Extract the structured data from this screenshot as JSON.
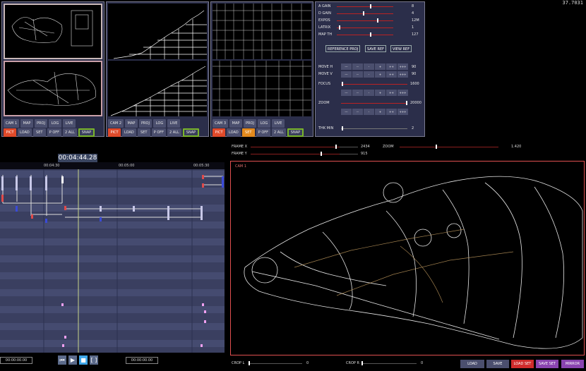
{
  "fps": "37.7031",
  "cameras": [
    {
      "name": "CAM 1",
      "row1": [
        "CAM 1",
        "MAP",
        "PROJ",
        "LOG",
        "LIVE"
      ],
      "row2": [
        "PICT",
        "LOAD",
        "SET",
        "P OFF",
        "2 ALL",
        "SNAP"
      ],
      "active_set": false
    },
    {
      "name": "CAM 2",
      "row1": [
        "CAM 2",
        "MAP",
        "PROJ",
        "LOG",
        "LIVE"
      ],
      "row2": [
        "PICT",
        "LOAD",
        "SET",
        "P OFF",
        "2 ALL",
        "SNAP"
      ],
      "active_set": false
    },
    {
      "name": "CAM 3",
      "row1": [
        "CAM 3",
        "MAP",
        "PROJ",
        "LOG",
        "LIVE"
      ],
      "row2": [
        "PICT",
        "LOAD",
        "SET",
        "P OFF",
        "2 ALL",
        "SNAP"
      ],
      "active_set": true
    }
  ],
  "settings": {
    "sliders": [
      {
        "label": "A GAIN",
        "value": "8",
        "level": 0.6
      },
      {
        "label": "D GAIN",
        "value": "4",
        "level": 0.47
      },
      {
        "label": "EXPOS",
        "value": "12M",
        "level": 0.73
      },
      {
        "label": "LATRIX",
        "value": "1",
        "level": 0.05
      },
      {
        "label": "MAP TH",
        "value": "127",
        "level": 0.6
      }
    ],
    "buttons": [
      "REFERENCE PROJ",
      "SAVE REF",
      "VIEW REF"
    ],
    "move_h": {
      "label": "MOVE H",
      "value": "90"
    },
    "move_v": {
      "label": "MOVE V",
      "value": "90"
    },
    "focus": {
      "label": "FOCUS",
      "value": "1600",
      "level": 0.02
    },
    "zoom": {
      "label": "ZOOM",
      "value": "20000",
      "level": 1.0
    },
    "thk": {
      "label": "THK MIN",
      "value": "2",
      "level": 0.02
    },
    "steps": [
      "---",
      "--",
      "-",
      "+",
      "++",
      "+++"
    ]
  },
  "frame": {
    "x_label": "FRAME X",
    "x_value": "2434",
    "x_level": 0.96,
    "y_label": "FRAME Y",
    "y_value": "915",
    "y_level": 0.79,
    "zoom_label": "ZOOM",
    "zoom_value": "1.420",
    "zoom_level": 0.37
  },
  "timeline": {
    "current": "00:04:44.28",
    "ticks": [
      "00:04:30",
      "00:05:00",
      "00:05:30"
    ],
    "start": "00:00:00.00",
    "end": "00:00:00.00"
  },
  "main_view": {
    "label": "CAM 1"
  },
  "crop": {
    "l_label": "CROP L",
    "l_value": "0",
    "r_label": "CROP R",
    "r_value": "0"
  },
  "bottom_buttons": [
    "LOAD",
    "SAVE",
    "LOAD SET",
    "SAVE SET",
    "MIRROR"
  ],
  "colors": {
    "accent_red": "#e04a2a",
    "orange": "#e38a1d",
    "snap_green": "#7ab52b",
    "panel": "#2b2e4a"
  }
}
